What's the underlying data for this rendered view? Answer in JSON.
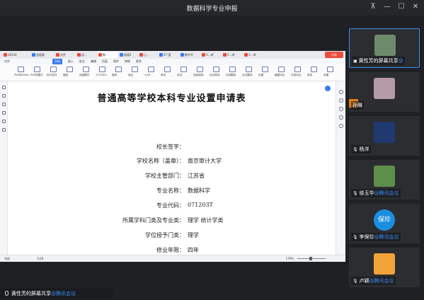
{
  "window": {
    "title": "数据科学专业申报"
  },
  "wps": {
    "tabs": [
      {
        "label": "20234",
        "color": "#e84d3d"
      },
      {
        "label": "首面版",
        "color": "#3b7cf0"
      },
      {
        "label": "文件",
        "color": "#e84d3d"
      },
      {
        "label": "机…",
        "color": "#e84d3d"
      },
      {
        "label": "数…",
        "color": "#e84d3d"
      },
      {
        "label": "新版2",
        "color": "#3b7cf0"
      },
      {
        "label": "江…",
        "color": "#e84d3d"
      },
      {
        "label": "57 国",
        "color": "#3b7cf0"
      },
      {
        "label": "数字专",
        "color": "#3b7cf0"
      },
      {
        "label": "3…df",
        "color": "#e84d3d"
      },
      {
        "label": "5…df",
        "color": "#e84d3d"
      },
      {
        "label": "5…df",
        "color": "#e84d3d"
      }
    ],
    "share_button": "分享",
    "menu": [
      "文件",
      "开始",
      "插入",
      "批注",
      "编辑",
      "页面",
      "保护",
      "转换",
      "更多"
    ],
    "active_menu": "开始",
    "toolbar": [
      "PDF转Office",
      "PDF转图片",
      "拆分合并",
      "播放",
      "阅读模式",
      "179.56%",
      "旋转",
      "适合",
      "1/28",
      "单页",
      "双页",
      "连续阅读",
      "自动滚动",
      "划词翻译",
      "全文翻译",
      "压缩",
      "截图对比",
      "文档对比",
      "查找",
      "设置"
    ],
    "page_indicator": "1/28",
    "zoom": "179.56%",
    "status_left": "导航",
    "status_page": "1/28",
    "status_zoom": "179%"
  },
  "document": {
    "title": "普通高等学校本科专业设置申请表",
    "fields": [
      {
        "label": "校长签字：",
        "value": ""
      },
      {
        "label": "学校名称（盖章）：",
        "value": "南京审计大学"
      },
      {
        "label": "学校主管部门：",
        "value": "江苏省"
      },
      {
        "label": "专业名称：",
        "value": "数据科学"
      },
      {
        "label": "专业代码：",
        "value": "071203T"
      },
      {
        "label": "所属学科门类及专业类：",
        "value": "理学  统计学类"
      },
      {
        "label": "学位授予门类：",
        "value": "理学"
      },
      {
        "label": "修业年限：",
        "value": "四年"
      }
    ]
  },
  "caption": {
    "name": "黄性芳的屏幕共享",
    "suffix": "@腾讯会议"
  },
  "participants": [
    {
      "name": "黄性芳的屏幕共享",
      "suffix": "@",
      "avatar_color": "#6e8a6a",
      "icon": "screen-share-icon"
    },
    {
      "name": "孙琳",
      "suffix": "",
      "avatar_color": "#b69aa5",
      "icon": "host-icon"
    },
    {
      "name": "杨洋",
      "suffix": "",
      "avatar_color": "#1f3a6e",
      "icon": "mic-icon"
    },
    {
      "name": "徐玉华",
      "suffix": "@腾讯会议",
      "avatar_color": "#5d8f4a",
      "icon": "mic-icon"
    },
    {
      "name": "李保珍",
      "suffix": "@腾讯会议",
      "avatar_text": "保珍",
      "avatar_color": "#1a8fe0",
      "icon": "mic-icon"
    },
    {
      "name": "卢颖",
      "suffix": "@腾讯会议",
      "avatar_color": "#f2a33a",
      "icon": "mic-muted-icon"
    }
  ]
}
